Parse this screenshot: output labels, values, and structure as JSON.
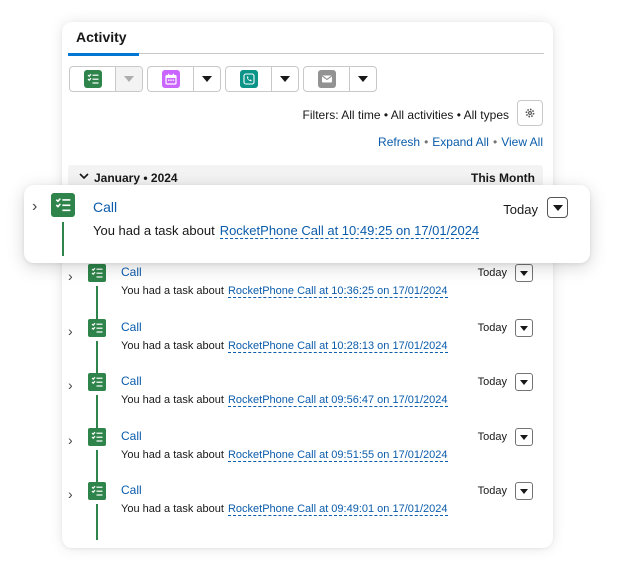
{
  "tabs": [
    {
      "label": "Activity",
      "active": true
    }
  ],
  "composer": [
    {
      "icon": "task-icon",
      "color": "#2e844a",
      "dropdown_disabled": true
    },
    {
      "icon": "calendar-icon",
      "color": "#cb65ff",
      "dropdown_disabled": false
    },
    {
      "icon": "phone-icon",
      "color": "#0d9488",
      "dropdown_disabled": false
    },
    {
      "icon": "email-icon",
      "color": "#939393",
      "dropdown_disabled": false
    }
  ],
  "filters": {
    "text": "Filters: All time • All activities • All types"
  },
  "links": {
    "refresh": "Refresh",
    "expand_all": "Expand All",
    "view_all": "View All",
    "separator": "•"
  },
  "month_group": {
    "label": "January • 2024",
    "right": "This Month"
  },
  "highlighted": {
    "title": "Call",
    "description": "You had a task about",
    "link": "RocketPhone Call at 10:49:25 on 17/01/2024",
    "date": "Today"
  },
  "items": [
    {
      "title": "Call",
      "description": "You had a task about",
      "link": "RocketPhone Call at 10:36:25 on 17/01/2024",
      "date": "Today"
    },
    {
      "title": "Call",
      "description": "You had a task about",
      "link": "RocketPhone Call at 10:28:13 on 17/01/2024",
      "date": "Today"
    },
    {
      "title": "Call",
      "description": "You had a task about",
      "link": "RocketPhone Call at 09:56:47 on 17/01/2024",
      "date": "Today"
    },
    {
      "title": "Call",
      "description": "You had a task about",
      "link": "RocketPhone Call at 09:51:55 on 17/01/2024",
      "date": "Today"
    },
    {
      "title": "Call",
      "description": "You had a task about",
      "link": "RocketPhone Call at 09:49:01 on 17/01/2024",
      "date": "Today"
    }
  ],
  "colors": {
    "accent": "#0176d3",
    "link": "#0b5cab",
    "task_green": "#2e844a"
  }
}
